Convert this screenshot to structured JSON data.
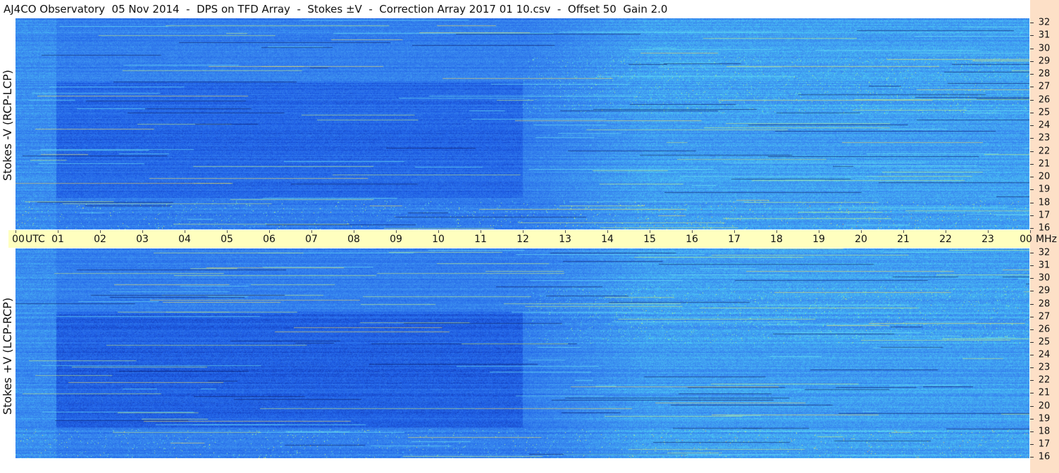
{
  "title": "AJ4CO Observatory  05 Nov 2014  -  DPS on TFD Array  -  Stokes ±V  -  Correction Array 2017 01 10.csv  -  Offset 50  Gain 2.0",
  "chart_data": [
    {
      "type": "heatmap",
      "ylabel": "Stokes -V (RCP-LCP)",
      "xlabel_unit": "UTC",
      "ylabel_unit": "MHz",
      "x_range_hours": [
        0,
        24
      ],
      "y_range_mhz": [
        16,
        32
      ],
      "x_ticks": [
        "00",
        "01",
        "02",
        "03",
        "04",
        "05",
        "06",
        "07",
        "08",
        "09",
        "10",
        "11",
        "12",
        "13",
        "14",
        "15",
        "16",
        "17",
        "18",
        "19",
        "20",
        "21",
        "22",
        "23",
        "00"
      ],
      "y_ticks": [
        "32",
        "31",
        "30",
        "29",
        "28",
        "27",
        "26",
        "25",
        "24",
        "23",
        "22",
        "21",
        "20",
        "19",
        "18",
        "17",
        "16"
      ],
      "colormap": [
        "#0d2a9e",
        "#1f5fe6",
        "#3b8cf0",
        "#4fd4f5",
        "#8ef0a0",
        "#f0f060",
        "#f06040"
      ]
    },
    {
      "type": "heatmap",
      "ylabel": "Stokes +V (LCP-RCP)",
      "xlabel_unit": "UTC",
      "ylabel_unit": "MHz",
      "x_range_hours": [
        0,
        24
      ],
      "y_range_mhz": [
        16,
        32
      ],
      "x_ticks": [
        "00",
        "01",
        "02",
        "03",
        "04",
        "05",
        "06",
        "07",
        "08",
        "09",
        "10",
        "11",
        "12",
        "13",
        "14",
        "15",
        "16",
        "17",
        "18",
        "19",
        "20",
        "21",
        "22",
        "23",
        "00"
      ],
      "y_ticks": [
        "32",
        "31",
        "30",
        "29",
        "28",
        "27",
        "26",
        "25",
        "24",
        "23",
        "22",
        "21",
        "20",
        "19",
        "18",
        "17",
        "16"
      ],
      "colormap": [
        "#0d2a9e",
        "#1f5fe6",
        "#3b8cf0",
        "#4fd4f5",
        "#8ef0a0",
        "#f0f060",
        "#f06040"
      ]
    }
  ],
  "axis": {
    "utc_label": "UTC",
    "mhz_label": "MHz"
  }
}
